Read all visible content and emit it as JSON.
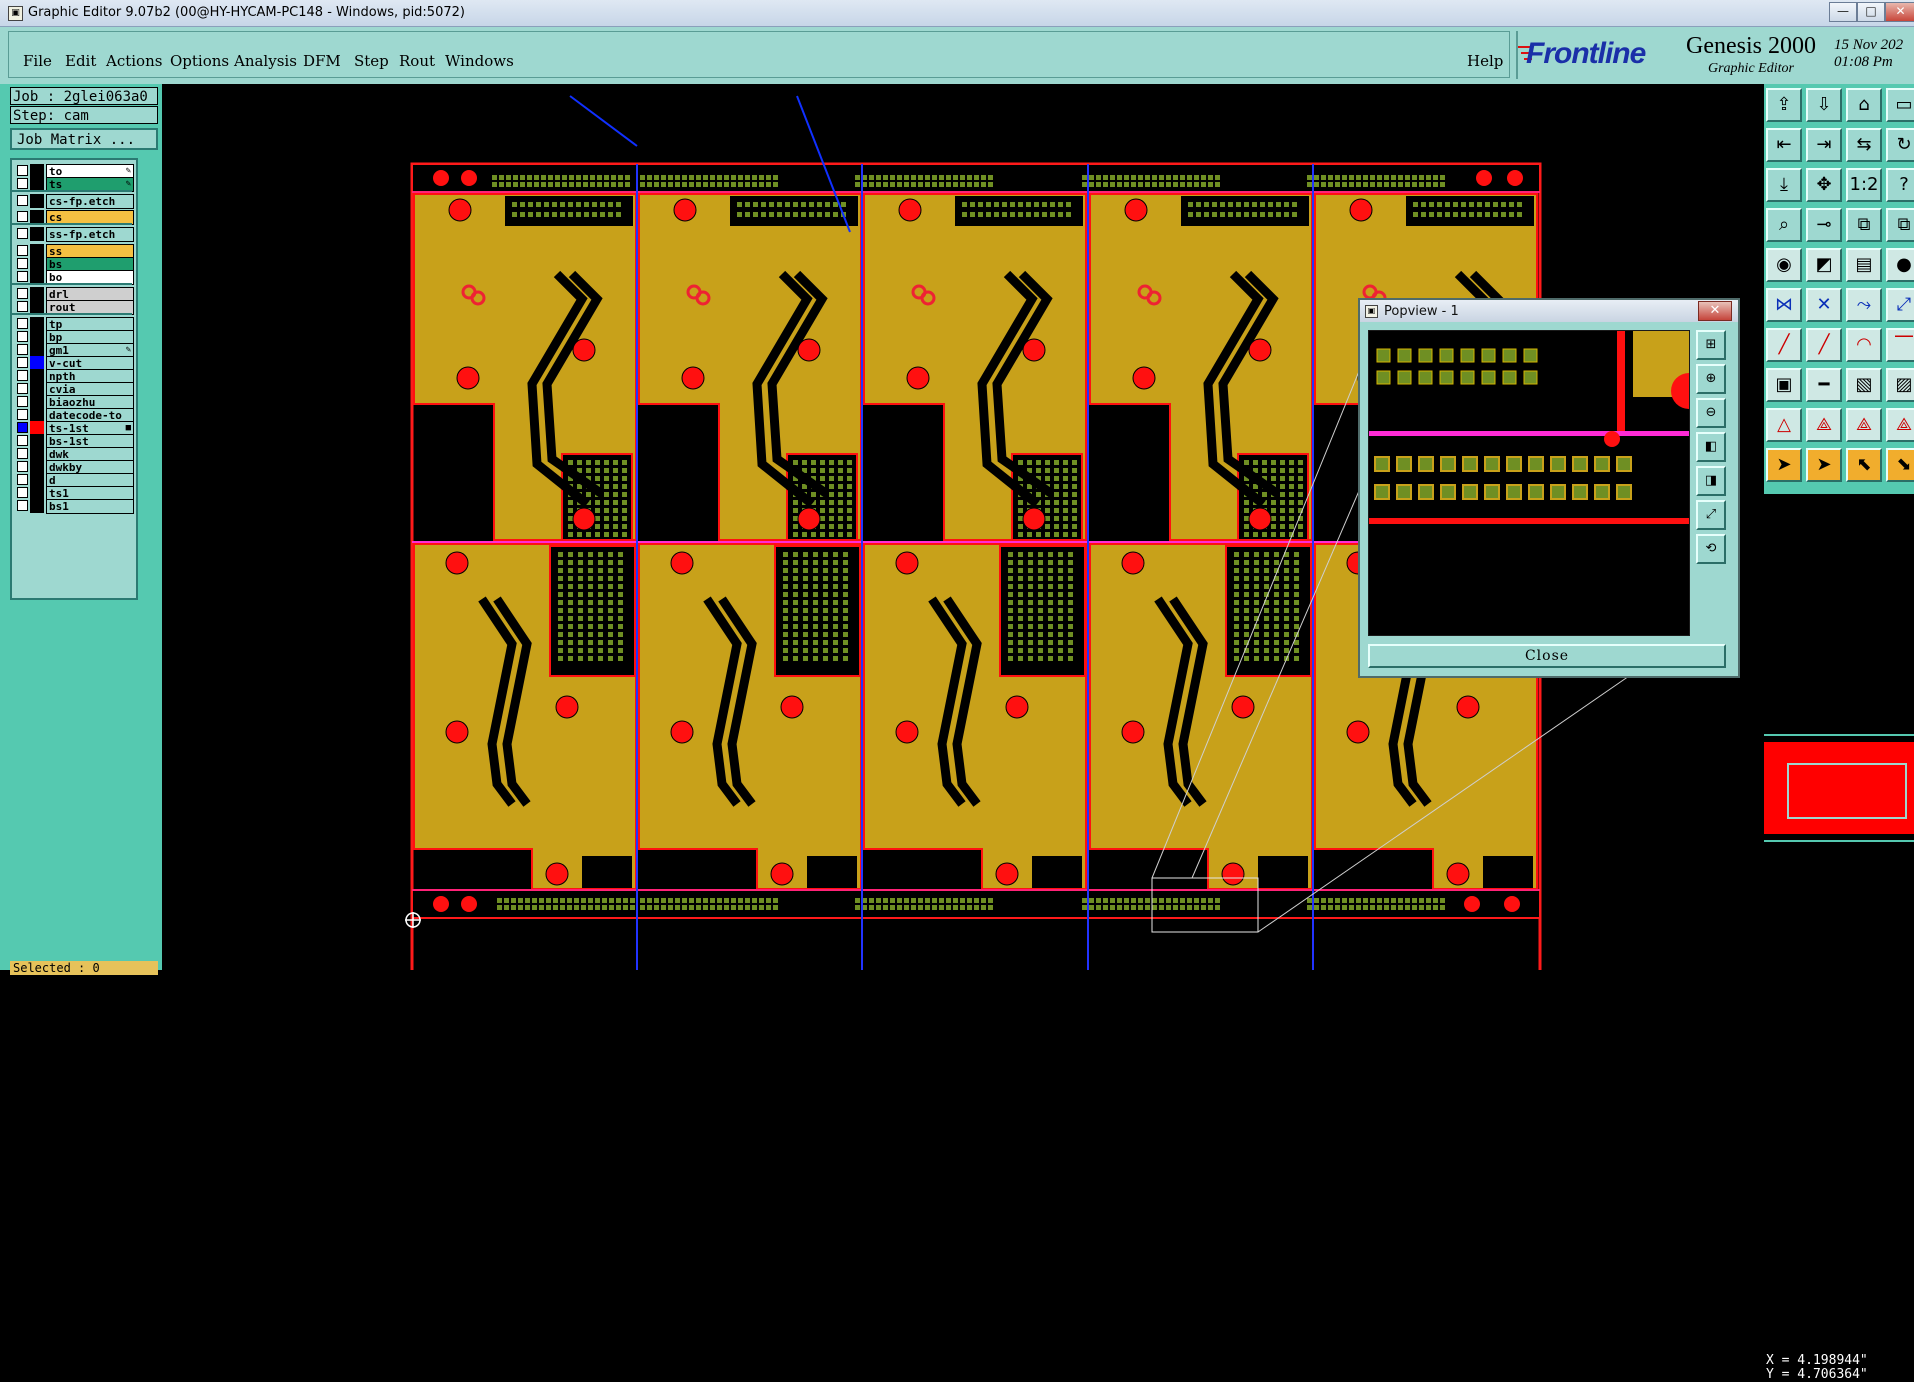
{
  "titlebar": {
    "title": "Graphic Editor 9.07b2 (00@HY-HYCAM-PC148 - Windows, pid:5072)",
    "minimize": "—",
    "maximize": "□",
    "close": "✕"
  },
  "menu": {
    "file": "File",
    "edit": "Edit",
    "actions": "Actions",
    "options": "Options",
    "analysis": "Analysis",
    "dfm": "DFM",
    "step": "Step",
    "rout": "Rout",
    "windows": "Windows",
    "help": "Help"
  },
  "branding": {
    "logo": "Frontline",
    "product": "Genesis 2000",
    "subtitle": "Graphic Editor",
    "date": "15 Nov 202",
    "time": "01:08 Pm"
  },
  "job": {
    "job_label": "Job : 2glei063a0",
    "step_label": "Step: cam",
    "job_matrix": "Job Matrix ..."
  },
  "layers": [
    {
      "name": "to",
      "color": "#ffffff"
    },
    {
      "name": "ts",
      "color": "#1f9e6e"
    },
    {
      "name": "cs-fp.etch",
      "color": "#9ed8d0"
    },
    {
      "name": "cs",
      "color": "#f5c042"
    },
    {
      "name": "ss-fp.etch",
      "color": "#9ed8d0"
    },
    {
      "name": "ss",
      "color": "#f5c042"
    },
    {
      "name": "bs",
      "color": "#1f9e6e"
    },
    {
      "name": "bo",
      "color": "#ffffff"
    },
    {
      "name": "drl",
      "color": "#cfcfcf"
    },
    {
      "name": "rout",
      "color": "#cfcfcf"
    },
    {
      "name": "tp",
      "color": "#9ed8d0"
    },
    {
      "name": "bp",
      "color": "#9ed8d0"
    },
    {
      "name": "gm1",
      "color": "#9ed8d0"
    },
    {
      "name": "v-cut",
      "color": "#9ed8d0"
    },
    {
      "name": "npth",
      "color": "#9ed8d0"
    },
    {
      "name": "cvia",
      "color": "#9ed8d0"
    },
    {
      "name": "biaozhu",
      "color": "#9ed8d0"
    },
    {
      "name": "datecode-to",
      "color": "#9ed8d0"
    },
    {
      "name": "ts-1st",
      "color": "#9ed8d0"
    },
    {
      "name": "bs-1st",
      "color": "#9ed8d0"
    },
    {
      "name": "dwk",
      "color": "#9ed8d0"
    },
    {
      "name": "dwkby",
      "color": "#9ed8d0"
    },
    {
      "name": "d",
      "color": "#9ed8d0"
    },
    {
      "name": "ts1",
      "color": "#9ed8d0"
    },
    {
      "name": "bs1",
      "color": "#9ed8d0"
    }
  ],
  "status": {
    "selected": "Selected : 0",
    "x": "X = 4.198944\"",
    "y": "Y = 4.706364\""
  },
  "popview": {
    "title": "Popview - 1",
    "close_label": "Close"
  },
  "colors": {
    "panel": "#55c9b0",
    "menubar": "#9ed8d0",
    "board": "#c8a11a",
    "outline": "#ff1a1a",
    "pad": "#6f8f23",
    "route": "#ff2bd6"
  }
}
